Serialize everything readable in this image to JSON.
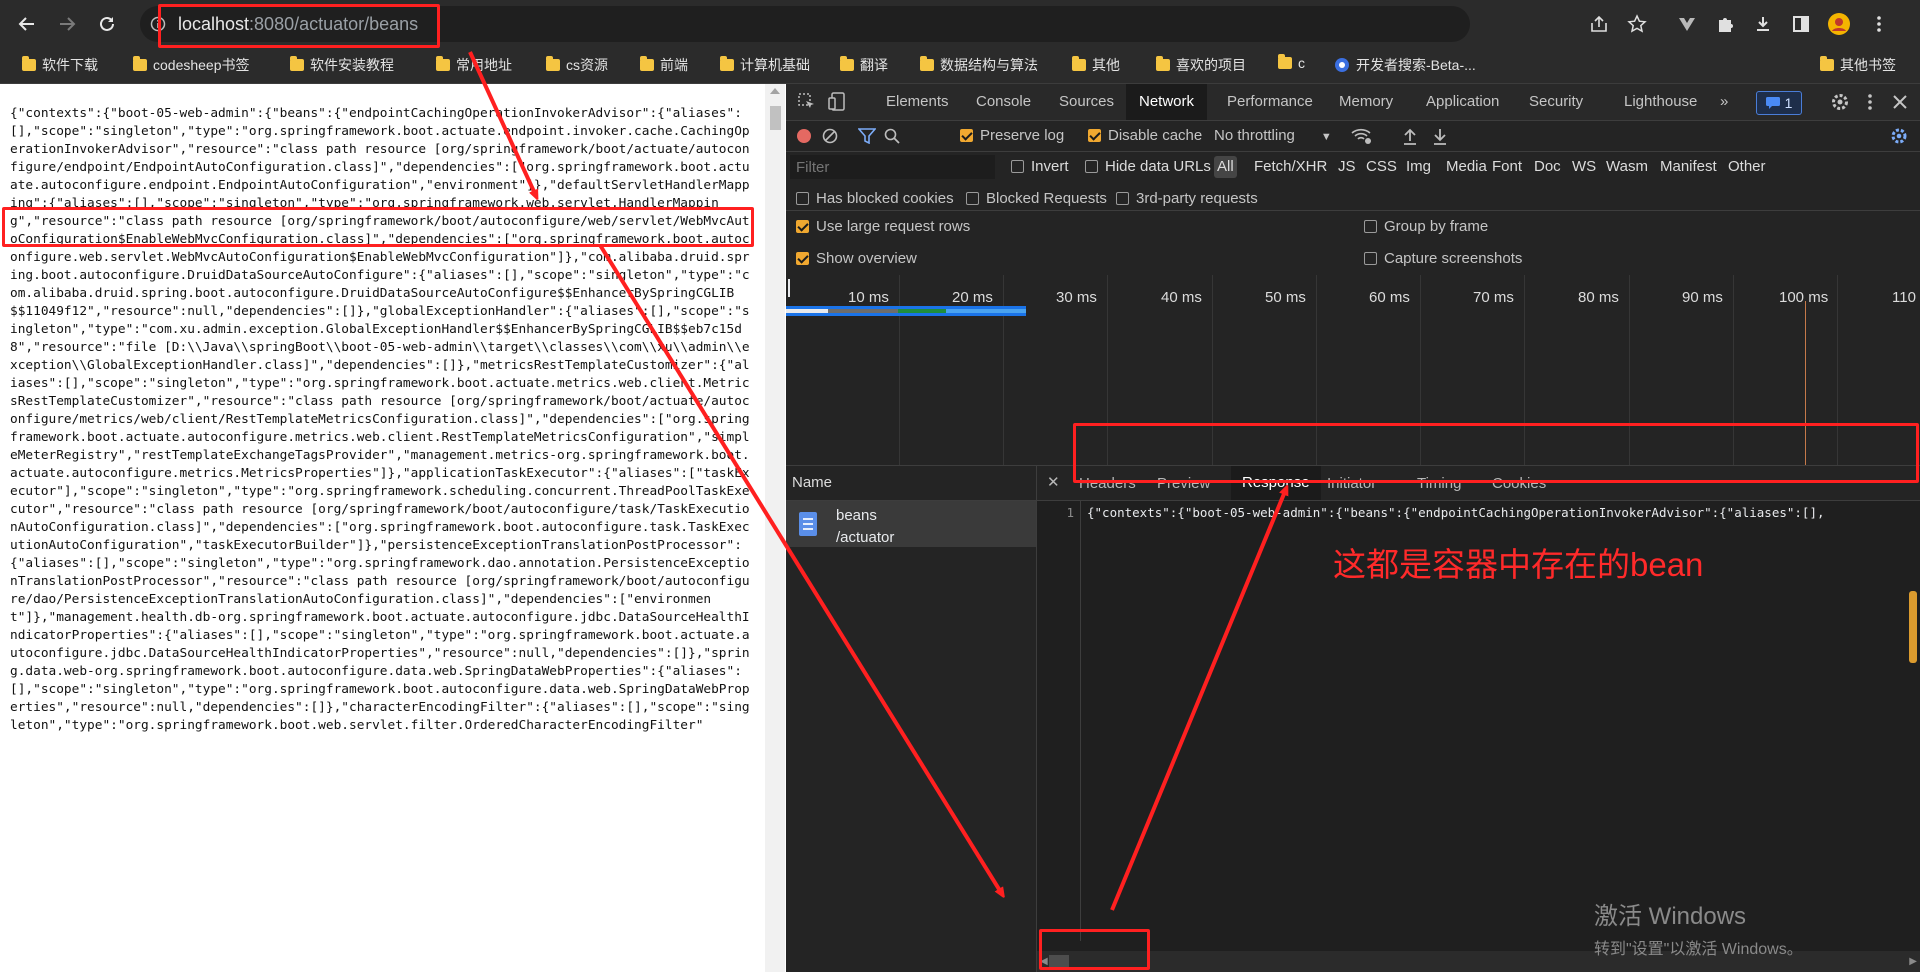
{
  "browser": {
    "url_host": "localhost",
    "url_path": ":8080/actuator/beans",
    "bookmarks": [
      "软件下载",
      "codesheep书签",
      "软件安装教程",
      "常用地址",
      "cs资源",
      "前端",
      "计算机基础",
      "翻译",
      "数据结构与算法",
      "其他",
      "喜欢的项目",
      "c",
      "开发者搜索-Beta-...",
      "其他书签"
    ]
  },
  "page": {
    "json_text": "{\"contexts\":{\"boot-05-web-admin\":{\"beans\":{\"endpointCachingOperationInvokerAdvisor\":{\"aliases\":[],\"scope\":\"singleton\",\"type\":\"org.springframework.boot.actuate.endpoint.invoker.cache.CachingOperationInvokerAdvisor\",\"resource\":\"class path resource [org/springframework/boot/actuate/autoconfigure/endpoint/EndpointAutoConfiguration.class]\",\"dependencies\":[\"org.springframework.boot.actuate.autoconfigure.endpoint.EndpointAutoConfiguration\",\"environment\"]},\"defaultServletHandlerMapping\":{\"aliases\":[],\"scope\":\"singleton\",\"type\":\"org.springframework.web.servlet.HandlerMapping\",\"resource\":\"class path resource [org/springframework/boot/autoconfigure/web/servlet/WebMvcAutoConfiguration$EnableWebMvcConfiguration.class]\",\"dependencies\":[\"org.springframework.boot.autoconfigure.web.servlet.WebMvcAutoConfiguration$EnableWebMvcConfiguration\"]},\"com.alibaba.druid.spring.boot.autoconfigure.DruidDataSourceAutoConfigure\":{\"aliases\":[],\"scope\":\"singleton\",\"type\":\"com.alibaba.druid.spring.boot.autoconfigure.DruidDataSourceAutoConfigure$$EnhancerBySpringCGLIB$$11049f12\",\"resource\":null,\"dependencies\":[]},\"globalExceptionHandler\":{\"aliases\":[],\"scope\":\"singleton\",\"type\":\"com.xu.admin.exception.GlobalExceptionHandler$$EnhancerBySpringCGLIB$$eb7c15d8\",\"resource\":\"file [D:\\\\Java\\\\springBoot\\\\boot-05-web-admin\\\\target\\\\classes\\\\com\\\\xu\\\\admin\\\\exception\\\\GlobalExceptionHandler.class]\",\"dependencies\":[]},\"metricsRestTemplateCustomizer\":{\"aliases\":[],\"scope\":\"singleton\",\"type\":\"org.springframework.boot.actuate.metrics.web.client.MetricsRestTemplateCustomizer\",\"resource\":\"class path resource [org/springframework/boot/actuate/autoconfigure/metrics/web/client/RestTemplateMetricsConfiguration.class]\",\"dependencies\":[\"org.springframework.boot.actuate.autoconfigure.metrics.web.client.RestTemplateMetricsConfiguration\",\"simpleMeterRegistry\",\"restTemplateExchangeTagsProvider\",\"management.metrics-org.springframework.boot.actuate.autoconfigure.metrics.MetricsProperties\"]},\"applicationTaskExecutor\":{\"aliases\":[\"taskExecutor\"],\"scope\":\"singleton\",\"type\":\"org.springframework.scheduling.concurrent.ThreadPoolTaskExecutor\",\"resource\":\"class path resource [org/springframework/boot/autoconfigure/task/TaskExecutionAutoConfiguration.class]\",\"dependencies\":[\"org.springframework.boot.autoconfigure.task.TaskExecutionAutoConfiguration\",\"taskExecutorBuilder\"]},\"persistenceExceptionTranslationPostProcessor\":{\"aliases\":[],\"scope\":\"singleton\",\"type\":\"org.springframework.dao.annotation.PersistenceExceptionTranslationPostProcessor\",\"resource\":\"class path resource [org/springframework/boot/autoconfigure/dao/PersistenceExceptionTranslationAutoConfiguration.class]\",\"dependencies\":[\"environment\"]},\"management.health.db-org.springframework.boot.actuate.autoconfigure.jdbc.DataSourceHealthIndicatorProperties\":{\"aliases\":[],\"scope\":\"singleton\",\"type\":\"org.springframework.boot.actuate.autoconfigure.jdbc.DataSourceHealthIndicatorProperties\",\"resource\":null,\"dependencies\":[]},\"spring.data.web-org.springframework.boot.autoconfigure.data.web.SpringDataWebProperties\":{\"aliases\":[],\"scope\":\"singleton\",\"type\":\"org.springframework.boot.autoconfigure.data.web.SpringDataWebProperties\",\"resource\":null,\"dependencies\":[]},\"characterEncodingFilter\":{\"aliases\":[],\"scope\":\"singleton\",\"type\":\"org.springframework.boot.web.servlet.filter.OrderedCharacterEncodingFilter\"",
    "watermark_title": "激活 Windows",
    "watermark_sub": "转到\"设置\"以激活 Windows。",
    "annotation": "这都是容器中存在的bean"
  },
  "devtools": {
    "tabs": [
      "Elements",
      "Console",
      "Sources",
      "Network",
      "Performance",
      "Memory",
      "Application",
      "Security",
      "Lighthouse"
    ],
    "active_tab": "Network",
    "issues_count": "1",
    "toolbar": {
      "preserve_log": "Preserve log",
      "disable_cache": "Disable cache",
      "throttling": "No throttling"
    },
    "filter_placeholder": "Filter",
    "filter_checks": {
      "invert": "Invert",
      "hide_data_urls": "Hide data URLs"
    },
    "filter_types": [
      "All",
      "Fetch/XHR",
      "JS",
      "CSS",
      "Img",
      "Media",
      "Font",
      "Doc",
      "WS",
      "Wasm",
      "Manifest",
      "Other"
    ],
    "blocked": {
      "cookies": "Has blocked cookies",
      "requests": "Blocked Requests",
      "third_party": "3rd-party requests"
    },
    "options": {
      "large_rows": "Use large request rows",
      "show_overview": "Show overview",
      "group_by_frame": "Group by frame",
      "capture_screenshots": "Capture screenshots"
    },
    "timeline_ticks": [
      "10 ms",
      "20 ms",
      "30 ms",
      "40 ms",
      "50 ms",
      "60 ms",
      "70 ms",
      "80 ms",
      "90 ms",
      "100 ms",
      "110"
    ],
    "name_header": "Name",
    "request": {
      "name": "beans",
      "path": "/actuator"
    },
    "response_tabs": [
      "Headers",
      "Preview",
      "Response",
      "Initiator",
      "Timing",
      "Cookies"
    ],
    "active_response_tab": "Response",
    "line_number": "1",
    "response_line": "{\"contexts\":{\"boot-05-web-admin\":{\"beans\":{\"endpointCachingOperationInvokerAdvisor\":{\"aliases\":[],"
  },
  "colors": {
    "annotation": "#ff2a2a",
    "accent": "#f0a830",
    "devtools_bg": "#242424"
  }
}
